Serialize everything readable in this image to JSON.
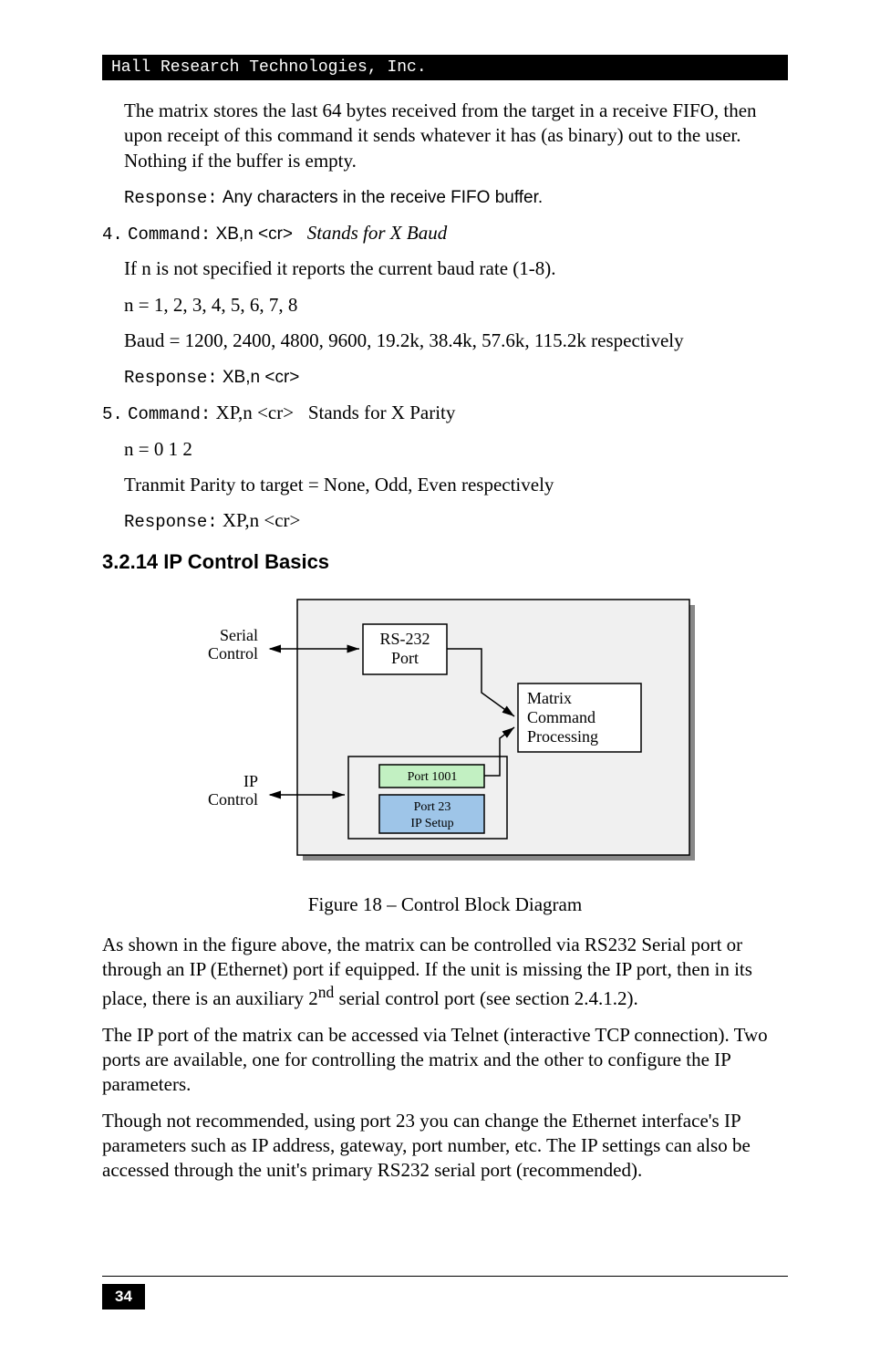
{
  "header": "Hall Research Technologies, Inc.",
  "para1": "The matrix stores the last 64 bytes received from the target in a receive FIFO, then upon receipt of this command it sends whatever it has (as binary) out to the user. Nothing if the buffer is empty.",
  "resp1_label": "Response:",
  "resp1_text": "Any characters in the receive FIFO buffer.",
  "cmd4_num": "4.",
  "cmd4_label": "Command:",
  "cmd4_val": "XB,n <cr>",
  "cmd4_desc": "Stands for X Baud",
  "cmd4_p1": "If n is not specified it reports the current baud rate (1-8).",
  "cmd4_p2": "n = 1, 2, 3, 4, 5, 6, 7, 8",
  "cmd4_p3": "Baud = 1200, 2400, 4800, 9600, 19.2k, 38.4k, 57.6k, 115.2k respectively",
  "cmd4_resp_label": "Response:",
  "cmd4_resp_val": "XB,n <cr>",
  "cmd5_num": "5.",
  "cmd5_label": "Command:",
  "cmd5_val": "XP,n <cr>",
  "cmd5_desc": "Stands for X Parity",
  "cmd5_p1": "n = 0 1 2",
  "cmd5_p2": "Tranmit Parity to target = None, Odd, Even   respectively",
  "cmd5_resp_label": "Response:",
  "cmd5_resp_val": "XP,n <cr>",
  "heading": "3.2.14 IP Control Basics",
  "diagram": {
    "serial_control": "Serial\nControl",
    "ip_control": "IP\nControl",
    "rs232": "RS-232\nPort",
    "matrix": "Matrix\nCommand\nProcessing",
    "port1001": "Port 1001",
    "port23": "Port 23",
    "ipsetup": "IP Setup"
  },
  "figure_caption": "Figure 18 – Control Block Diagram",
  "para2": "As shown in the figure above, the matrix can be controlled via RS232 Serial port or through an IP (Ethernet) port if equipped. If the unit is missing the IP port, then in its place, there is an auxiliary 2",
  "para2_sup": "nd",
  "para2_tail": " serial control port (see section 2.4.1.2).",
  "para3": "The IP port of the matrix can be accessed via Telnet (interactive TCP connection). Two ports are available, one for controlling the matrix and the other to configure the IP parameters.",
  "para4": "Though not recommended, using port 23 you can change the Ethernet interface's IP parameters such as IP address, gateway, port number, etc. The IP settings can also be accessed through the unit's primary RS232 serial port (recommended).",
  "page_num": "34"
}
